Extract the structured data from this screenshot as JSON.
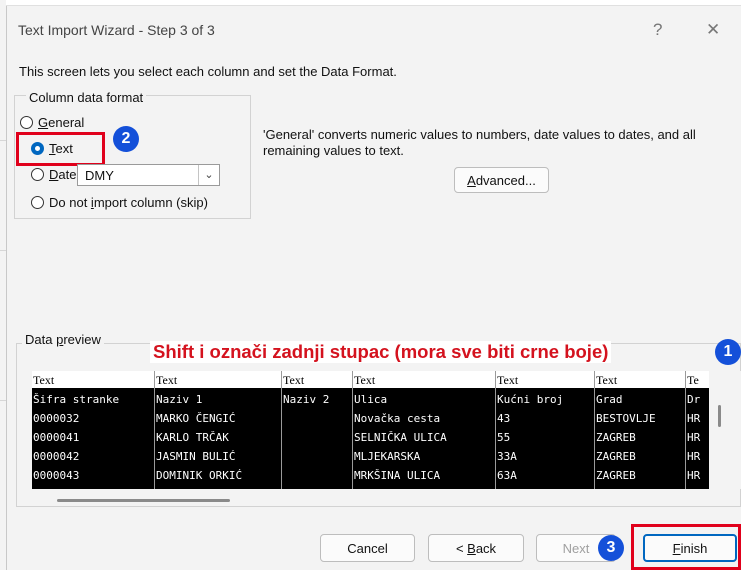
{
  "window": {
    "title": "Text Import Wizard - Step 3 of 3",
    "help_glyph": "?",
    "close_glyph": "✕"
  },
  "intro_text": "This screen lets you select each column and set the Data Format.",
  "column_format": {
    "label": "Column data format",
    "options": [
      {
        "label": "General",
        "accel": "G",
        "rest": "eneral",
        "selected": false
      },
      {
        "label": "Text",
        "accel": "T",
        "rest": "ext",
        "selected": true
      },
      {
        "label": "Date:",
        "accel": "D",
        "rest": "ate:",
        "selected": false
      },
      {
        "label": "Do not import column (skip)",
        "pre": "Do not ",
        "accel": "i",
        "rest": "mport column (skip)",
        "selected": false
      }
    ],
    "date_select_value": "DMY"
  },
  "description": "'General' converts numeric values to numbers, date values to dates, and all remaining values to text.",
  "advanced_button": {
    "label": "Advanced...",
    "accel": "A",
    "rest": "dvanced..."
  },
  "data_preview": {
    "label_pre": "Data ",
    "label_accel": "p",
    "label_rest": "review",
    "headers": [
      "Text",
      "Text",
      "Text",
      "Text",
      "Text",
      "Text",
      "Te"
    ],
    "rows": [
      [
        "Šifra stranke",
        "Naziv 1",
        "Naziv 2",
        "Ulica",
        "Kućni broj",
        "Grad",
        "Dr"
      ],
      [
        "0000032",
        "MARKO ČENGIĆ",
        "",
        "Novačka cesta",
        "43",
        "BESTOVLJE",
        "HR"
      ],
      [
        "0000041",
        "KARLO TRČAK",
        "",
        "SELNIČKA ULICA",
        "55",
        "ZAGREB",
        "HR"
      ],
      [
        "0000042",
        "JASMIN BULIĆ",
        "",
        "MLJEKARSKA",
        "33A",
        "ZAGREB",
        "HR"
      ],
      [
        "0000043",
        "DOMINIK ORKIĆ",
        "",
        "MRKŠINA ULICA",
        "63A",
        "ZAGREB",
        "HR"
      ]
    ]
  },
  "annotations": {
    "instruction": "Shift i označi zadnji stupac (mora sve biti crne boje)",
    "badge_1": "1",
    "badge_2": "2",
    "badge_3": "3",
    "highlight_color": "#e0001b",
    "badge_color": "#1450d9"
  },
  "buttons": {
    "cancel": "Cancel",
    "back_prefix": "< ",
    "back_accel": "B",
    "back_rest": "ack",
    "next": "Next",
    "finish_accel": "F",
    "finish_rest": "inish"
  }
}
